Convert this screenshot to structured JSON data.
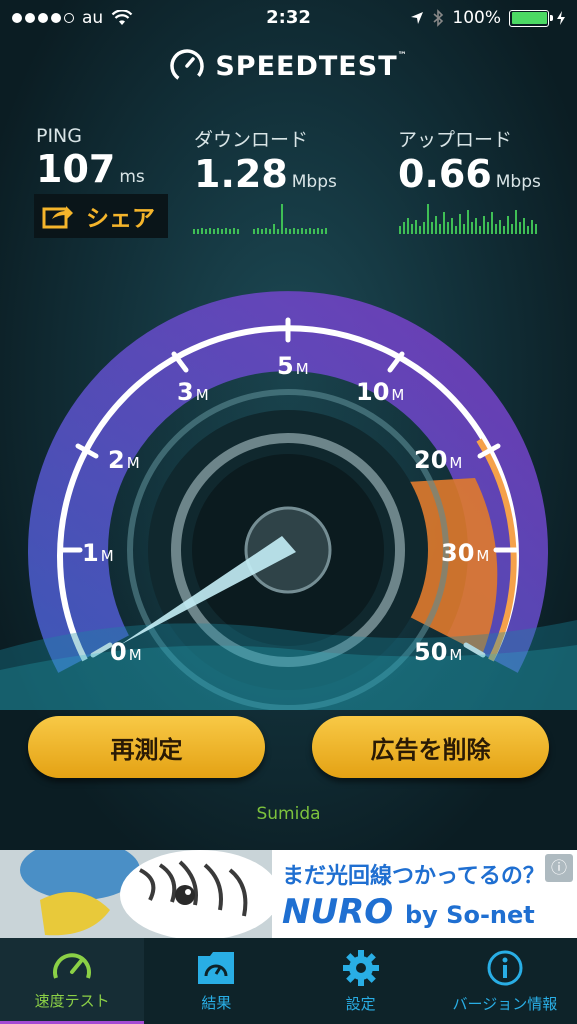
{
  "status_bar": {
    "carrier": "au",
    "time": "2:32",
    "battery": "100%"
  },
  "app": {
    "logo_text": "SPEEDTEST",
    "logo_tm": "™"
  },
  "stats": {
    "ping": {
      "label": "PING",
      "value": "107",
      "unit": "ms"
    },
    "download": {
      "label": "ダウンロード",
      "value": "1.28",
      "unit": "Mbps"
    },
    "upload": {
      "label": "アップロード",
      "value": "0.66",
      "unit": "Mbps"
    },
    "share_label": "シェア"
  },
  "gauge": {
    "labels": [
      {
        "num": "0",
        "unit": "M"
      },
      {
        "num": "1",
        "unit": "M"
      },
      {
        "num": "2",
        "unit": "M"
      },
      {
        "num": "3",
        "unit": "M"
      },
      {
        "num": "5",
        "unit": "M"
      },
      {
        "num": "10",
        "unit": "M"
      },
      {
        "num": "20",
        "unit": "M"
      },
      {
        "num": "30",
        "unit": "M"
      },
      {
        "num": "50",
        "unit": "M"
      }
    ],
    "reading_mbps": 0.66,
    "colors": {
      "arc_low": "#7a4fd6",
      "arc_high": "#f08a35",
      "needle": "#bfe9f2"
    }
  },
  "buttons": {
    "retest": "再測定",
    "remove_ads": "広告を削除"
  },
  "location": "Sumida",
  "ad": {
    "line1": "まだ光回線つかってるの？",
    "brand": "NURO",
    "brand_suffix": "by So-net"
  },
  "tabs": [
    {
      "label": "速度テスト",
      "icon": "speedometer-icon",
      "active": true
    },
    {
      "label": "結果",
      "icon": "results-icon",
      "active": false
    },
    {
      "label": "設定",
      "icon": "gear-icon",
      "active": false
    },
    {
      "label": "バージョン情報",
      "icon": "info-icon",
      "active": false
    }
  ]
}
